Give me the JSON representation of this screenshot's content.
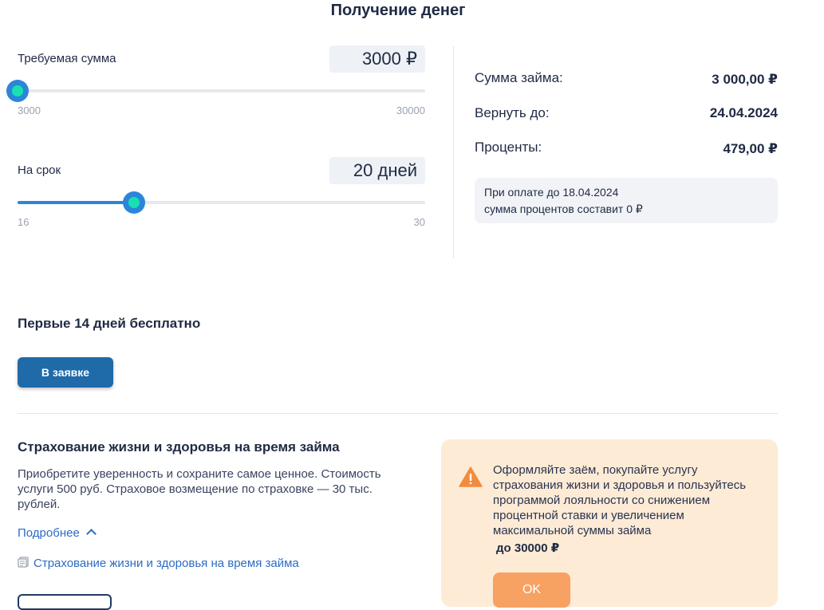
{
  "header": {
    "title": "Получение денег"
  },
  "amount": {
    "label": "Требуемая сумма",
    "value": "3000 ₽",
    "min_label": "3000",
    "max_label": "30000",
    "min": 3000,
    "max": 30000,
    "current": 3000
  },
  "term": {
    "label": "На срок",
    "value": "20 дней",
    "min_label": "16",
    "max_label": "30",
    "min": 16,
    "max": 30,
    "current": 20
  },
  "summary": {
    "loan_label": "Сумма займа:",
    "loan_value": "3 000,00 ₽",
    "return_label": "Вернуть до:",
    "return_value": "24.04.2024",
    "interest_label": "Проценты:",
    "interest_value": "479,00 ₽",
    "note_line1": "При оплате до 18.04.2024",
    "note_line2": "сумма процентов составит 0 ₽"
  },
  "promo": {
    "free_text": "Первые 14 дней бесплатно",
    "button_label": "В заявке"
  },
  "insurance": {
    "title": "Страхование жизни и здоровья на время займа",
    "description": "Приобретите уверенность и сохраните самое ценное. Стоимость услуги 500 руб. Страховое возмещение по страховке — 30 тыс. рублей.",
    "more_label": "Подробнее",
    "doc_link": "Страхование жизни и здоровья на время займа"
  },
  "warning": {
    "text": "Оформляйте заём, покупайте услугу страхования жизни и здоровья и пользуйтесь программой лояльности со снижением процентной ставки и увеличением максимальной суммы займа",
    "bold_text": "до 30000 ₽",
    "ok_label": "OK"
  },
  "colors": {
    "accent": "#2b86d9",
    "thumb_inner": "#19e0b0",
    "primary_button": "#1f6aa8",
    "warning_bg": "#fdebd6",
    "ok_button": "#f7a163"
  }
}
